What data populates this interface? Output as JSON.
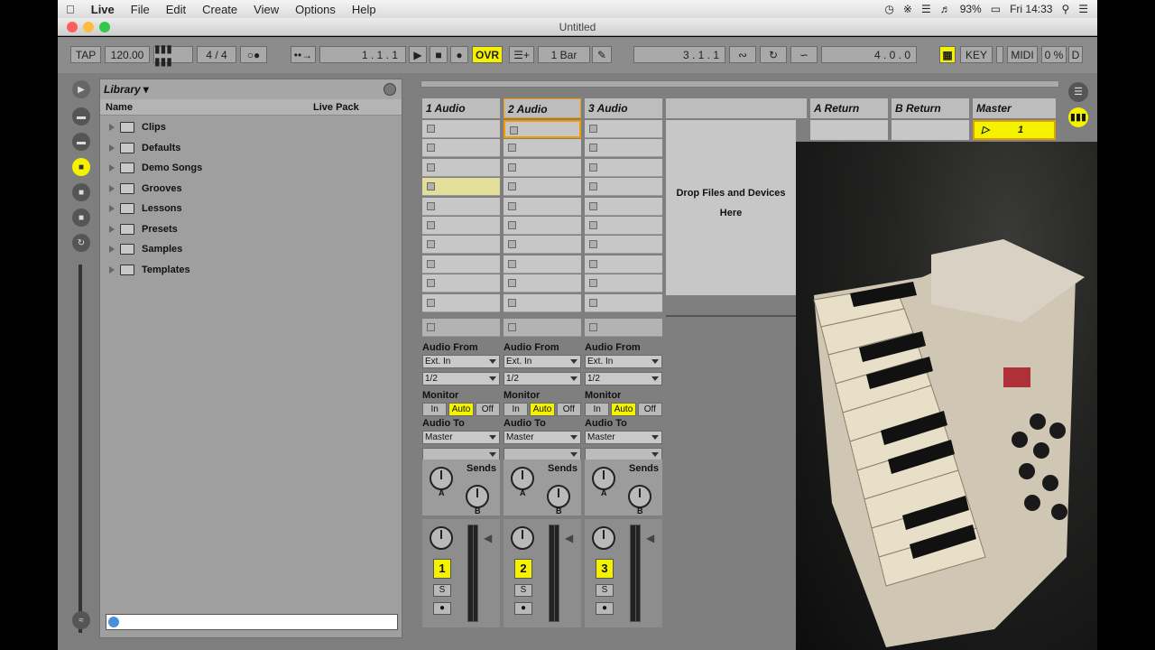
{
  "menubar": {
    "apple": "",
    "app": "Live",
    "items": [
      "File",
      "Edit",
      "Create",
      "View",
      "Options",
      "Help"
    ],
    "battery": "93%",
    "clock": "Fri 14:33"
  },
  "window": {
    "title": "Untitled"
  },
  "control": {
    "tap": "TAP",
    "tempo": "120.00",
    "signature": "4 / 4",
    "position": "1 .   1 .   1",
    "ovr": "OVR",
    "quant": "1 Bar",
    "loop_start": "3 .   1 .   1",
    "loop_len": "4 .   0 .   0",
    "key": "KEY",
    "midi": "MIDI",
    "cpu": "0 %",
    "d": "D"
  },
  "browser": {
    "title": "Library",
    "col_name": "Name",
    "col_pack": "Live Pack",
    "items": [
      "Clips",
      "Defaults",
      "Demo Songs",
      "Grooves",
      "Lessons",
      "Presets",
      "Samples",
      "Templates"
    ]
  },
  "session": {
    "tracks": [
      {
        "name": "1 Audio",
        "num": "1"
      },
      {
        "name": "2 Audio",
        "num": "2"
      },
      {
        "name": "3 Audio",
        "num": "3"
      }
    ],
    "drop_text": "Drop Files and Devices Here",
    "returns": [
      "A Return",
      "B Return"
    ],
    "master": "Master",
    "master_scene": "1",
    "io": {
      "audio_from": "Audio From",
      "ext_in": "Ext. In",
      "channel": "1/2",
      "monitor": "Monitor",
      "mon_in": "In",
      "mon_auto": "Auto",
      "mon_off": "Off",
      "audio_to": "Audio To",
      "dest": "Master",
      "sends": "Sends",
      "a": "A",
      "b": "B",
      "solo": "S"
    }
  },
  "colors": {
    "accent": "#f5f200",
    "panel": "#7e7e7e"
  }
}
